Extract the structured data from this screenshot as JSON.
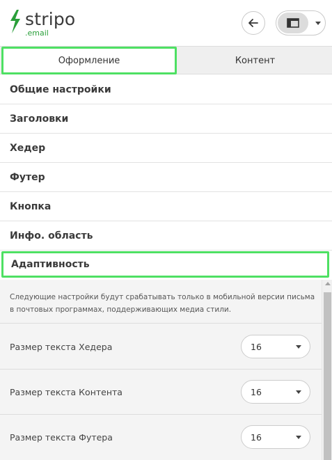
{
  "brand": {
    "name": "stripo",
    "sub": ".email",
    "accent": "#2a9f3a",
    "highlight": "#4ee063"
  },
  "header": {
    "back_icon": "arrow-left-icon",
    "layout_icon": "layout-panel-icon",
    "caret_icon": "chevron-down-icon"
  },
  "tabs": [
    {
      "label": "Оформление",
      "active": true
    },
    {
      "label": "Контент",
      "active": false
    }
  ],
  "menu": {
    "items": [
      {
        "label": "Общие настройки"
      },
      {
        "label": "Заголовки"
      },
      {
        "label": "Хедер"
      },
      {
        "label": "Футер"
      },
      {
        "label": "Кнопка"
      },
      {
        "label": "Инфо. область"
      }
    ],
    "active_label": "Адаптивность"
  },
  "responsive": {
    "note": "Следующие настройки будут срабатывать только в мобильной версии письма в почтовых программах, поддерживающих медиа стили.",
    "rows": [
      {
        "label": "Размер текста Хедера",
        "value": "16"
      },
      {
        "label": "Размер текста Контента",
        "value": "16"
      },
      {
        "label": "Размер текста Футера",
        "value": "16"
      }
    ]
  }
}
